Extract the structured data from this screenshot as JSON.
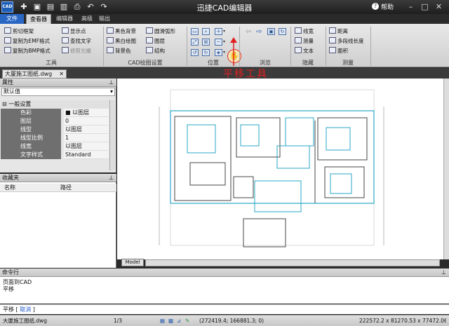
{
  "app": {
    "logo": "CAD",
    "title": "迅捷CAD编辑器",
    "help": "帮助"
  },
  "tabs": [
    "文件",
    "查看器",
    "编辑器",
    "高级",
    "输出"
  ],
  "ribbon": {
    "tools": {
      "items": [
        "剪切框架",
        "复制为EMF格式",
        "复制为BMP格式",
        "显示点",
        "查找文字",
        "修剪光栅"
      ],
      "label": "工具"
    },
    "drawing": {
      "items": [
        "黑色背景",
        "黑白绘图",
        "背景色",
        "圆滑弧形",
        "图层",
        "结构"
      ],
      "label": "CAD绘图设置"
    },
    "position": {
      "label": "位置"
    },
    "browse": {
      "label": "浏览"
    },
    "hide": {
      "items": [
        "线宽",
        "测量",
        "文本"
      ],
      "label": "隐藏"
    },
    "measure": {
      "items": [
        "距离",
        "多段线长度",
        "面积"
      ],
      "label": "测量"
    }
  },
  "annotation": "平移工具",
  "annotation_color": "#e02020",
  "document_tab": "大厦施工图纸.dwg",
  "properties": {
    "title": "属性",
    "default": "默认值",
    "group": "一般设置",
    "rows": [
      {
        "k": "色彩",
        "v": "■ 以图层"
      },
      {
        "k": "图层",
        "v": "0"
      },
      {
        "k": "线型",
        "v": "以图层"
      },
      {
        "k": "线型比例",
        "v": "1"
      },
      {
        "k": "线宽",
        "v": "以图层"
      },
      {
        "k": "文字样式",
        "v": "Standard"
      }
    ]
  },
  "favorites": {
    "title": "收藏夹",
    "col_name": "名称",
    "col_path": "路径"
  },
  "model_tab": "Model",
  "command": {
    "title": "命令行",
    "log": [
      "页面到CAD",
      "平移"
    ],
    "input": "平移",
    "cancel": "取消"
  },
  "status": {
    "file": "大厦施工图纸.dwg",
    "page": "1/3",
    "coords": "(272419.4; 166881.3; 0)",
    "size": "222572.2 x 81270.53 x 77472.06"
  }
}
